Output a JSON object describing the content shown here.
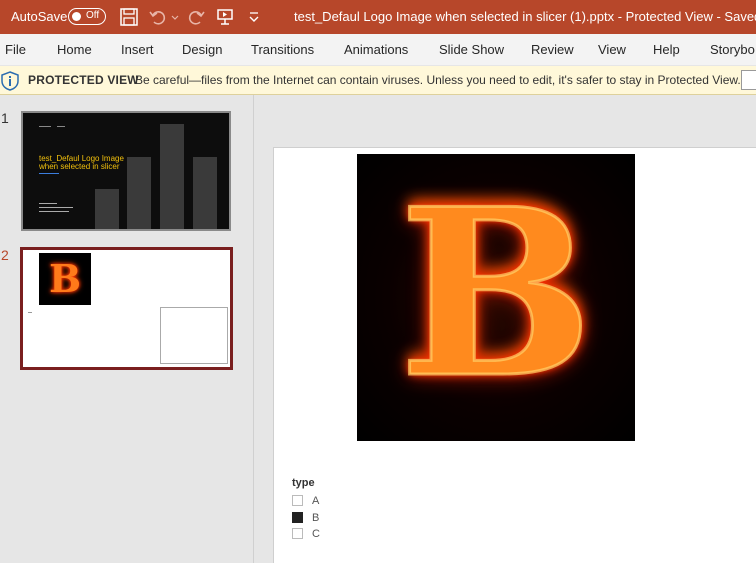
{
  "titlebar": {
    "autosave_label": "AutoSave",
    "autosave_toggle": "Off",
    "document_title": "test_Defaul Logo Image when selected in slicer (1).pptx  -  Protected View  -  Saved to thi",
    "background_color": "#b7472a"
  },
  "menu": {
    "items": [
      "File",
      "Home",
      "Insert",
      "Design",
      "Transitions",
      "Animations",
      "Slide Show",
      "Review",
      "View",
      "Help",
      "Storybo"
    ]
  },
  "protected_view": {
    "title": "PROTECTED VIEW",
    "message": "Be careful—files from the Internet can contain viruses. Unless you need to edit, it's safer to stay in Protected View."
  },
  "thumbnails": [
    {
      "number": "1",
      "title": "test_Defaul Logo Image when selected in slicer"
    },
    {
      "number": "2",
      "letter": "B"
    }
  ],
  "slide": {
    "image_letter": "B",
    "slicer": {
      "title": "type",
      "items": [
        {
          "label": "A",
          "selected": false
        },
        {
          "label": "B",
          "selected": true
        },
        {
          "label": "C",
          "selected": false
        }
      ]
    }
  }
}
